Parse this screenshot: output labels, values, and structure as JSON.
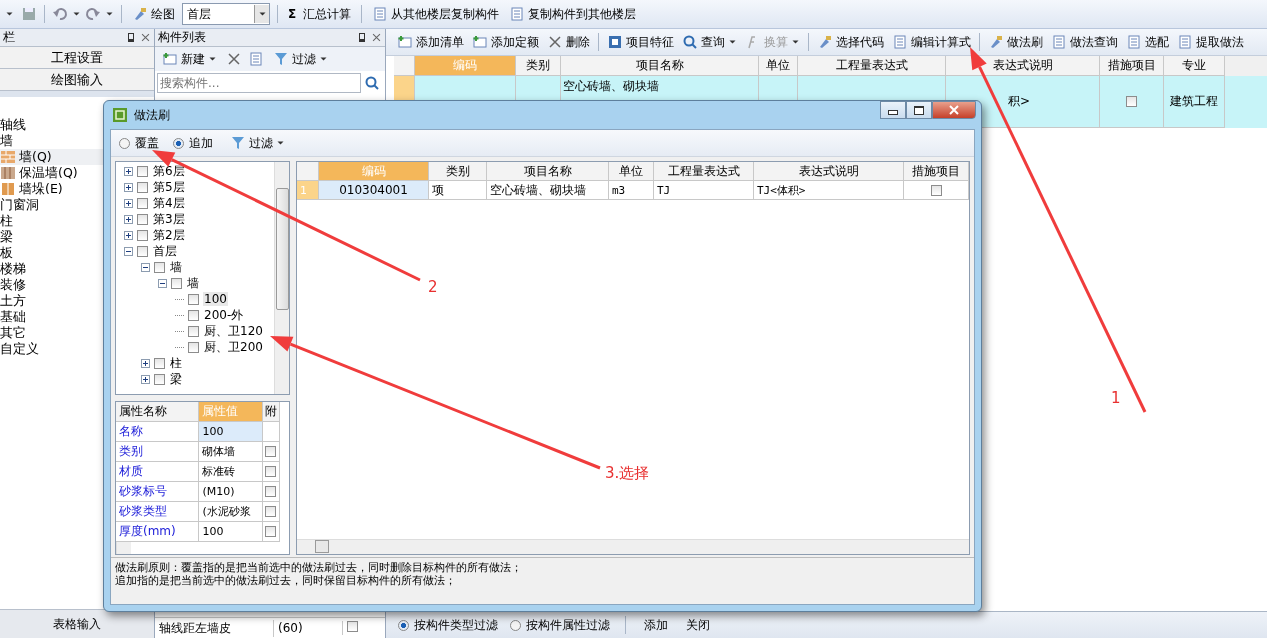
{
  "toolbar": {
    "draw_label": "绘图",
    "floor": "首层",
    "sum_icon": "Σ",
    "sum_label": "汇总计算",
    "copy_from": "从其他楼层复制构件",
    "copy_to": "复制构件到其他楼层"
  },
  "nav_panel": {
    "title": "栏",
    "buttons": [
      "工程设置",
      "绘图输入"
    ],
    "items": [
      {
        "label": "轴线",
        "kind": "folder"
      },
      {
        "label": "墙",
        "kind": "folder"
      },
      {
        "label": "墙(Q)",
        "kind": "wall",
        "selected": true
      },
      {
        "label": "保温墙(Q)",
        "kind": "insul",
        "selected": false
      },
      {
        "label": "墙垛(E)",
        "kind": "pillar",
        "selected": false
      },
      {
        "label": "门窗洞",
        "kind": "folder"
      },
      {
        "label": "柱",
        "kind": "folder"
      },
      {
        "label": "梁",
        "kind": "folder"
      },
      {
        "label": "板",
        "kind": "folder"
      },
      {
        "label": "楼梯",
        "kind": "folder"
      },
      {
        "label": "装修",
        "kind": "folder"
      },
      {
        "label": "土方",
        "kind": "folder"
      },
      {
        "label": "基础",
        "kind": "folder"
      },
      {
        "label": "其它",
        "kind": "folder"
      },
      {
        "label": "自定义",
        "kind": "folder"
      }
    ],
    "footer": "表格输入"
  },
  "component_list": {
    "title": "构件列表",
    "new_label": "新建",
    "filter_label": "过滤",
    "search_placeholder": "搜索构件...",
    "rows": [
      {
        "name": "轴线距左墙皮",
        "value": "(60)",
        "checked": false
      }
    ]
  },
  "methods": {
    "toolbar": [
      "添加清单",
      "添加定额",
      "删除",
      "项目特征",
      "查询",
      "换算",
      "选择代码",
      "编辑计算式",
      "做法刷",
      "做法查询",
      "选配",
      "提取做法"
    ],
    "columns": [
      "编码",
      "类别",
      "项目名称",
      "单位",
      "工程量表达式",
      "表达式说明",
      "措施项目",
      "专业"
    ],
    "row": {
      "name": "空心砖墙、砌块墙",
      "desc": "积>",
      "measure": false,
      "major": "建筑工程"
    },
    "filters": [
      {
        "label": "按构件类型过滤",
        "selected": true
      },
      {
        "label": "按构件属性过滤",
        "selected": false
      }
    ],
    "actions": [
      "添加",
      "关闭"
    ]
  },
  "dialog": {
    "title": "做法刷",
    "modes": [
      {
        "label": "覆盖",
        "selected": false
      },
      {
        "label": "追加",
        "selected": true
      }
    ],
    "filter_label": "过滤",
    "tree": [
      {
        "label": "第6层",
        "expanded": false,
        "checked": false
      },
      {
        "label": "第5层",
        "expanded": false,
        "checked": false
      },
      {
        "label": "第4层",
        "expanded": false,
        "checked": false
      },
      {
        "label": "第3层",
        "expanded": false,
        "checked": false
      },
      {
        "label": "第2层",
        "expanded": false,
        "checked": false
      },
      {
        "label": "首层",
        "expanded": true,
        "checked": false,
        "children": [
          {
            "label": "墙",
            "expanded": true,
            "checked": false,
            "children": [
              {
                "label": "墙",
                "expanded": true,
                "checked": false,
                "children": [
                  {
                    "label": "100",
                    "checked": false,
                    "selected": true
                  },
                  {
                    "label": "200-外",
                    "checked": false,
                    "selected": false
                  },
                  {
                    "label": "厨、卫120",
                    "checked": false,
                    "selected": false
                  },
                  {
                    "label": "厨、卫200",
                    "checked": false,
                    "selected": false
                  }
                ]
              }
            ]
          },
          {
            "label": "柱",
            "expanded": false,
            "checked": false
          },
          {
            "label": "梁",
            "expanded": false,
            "checked": false
          }
        ]
      }
    ],
    "prop_columns": [
      "属性名称",
      "属性值",
      "附"
    ],
    "props": [
      {
        "name": "名称",
        "value": "100"
      },
      {
        "name": "类别",
        "value": "砌体墙",
        "checked": false
      },
      {
        "name": "材质",
        "value": "标准砖",
        "checked": false
      },
      {
        "name": "砂浆标号",
        "value": "(M10)",
        "checked": false
      },
      {
        "name": "砂浆类型",
        "value": "(水泥砂浆",
        "checked": false
      },
      {
        "name": "厚度(mm)",
        "value": "100",
        "checked": false
      }
    ],
    "columns": [
      "编码",
      "类别",
      "项目名称",
      "单位",
      "工程量表达式",
      "表达式说明",
      "措施项目"
    ],
    "rows": [
      {
        "num": "1",
        "code": "010304001",
        "type": "项",
        "name": "空心砖墙、砌块墙",
        "unit": "m3",
        "expr": "TJ",
        "desc": "TJ<体积>",
        "measure": false
      }
    ],
    "note": [
      "做法刷原则：覆盖指的是把当前选中的做法刷过去，同时删除目标构件的所有做法；",
      "追加指的是把当前选中的做法刷过去，同时保留目标构件的所有做法；"
    ]
  },
  "annotations": [
    {
      "label": "1"
    },
    {
      "label": "2"
    },
    {
      "label": "3.选择"
    }
  ]
}
